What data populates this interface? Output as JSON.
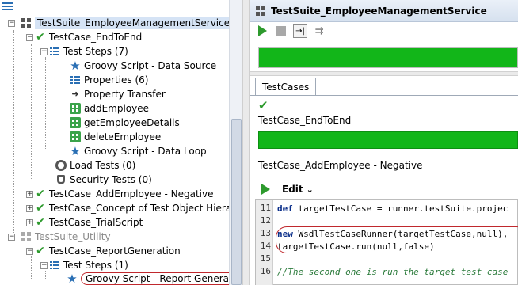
{
  "tree": {
    "suite": "TestSuite_EmployeeManagementService",
    "tc_end_to_end": "TestCase_EndToEnd",
    "test_steps_1": "Test Steps (7)",
    "step_groovy_ds": "Groovy Script - Data Source",
    "step_properties": "Properties (6)",
    "step_transfer": "Property Transfer",
    "step_add": "addEmployee",
    "step_get": "getEmployeeDetails",
    "step_delete": "deleteEmployee",
    "step_groovy_loop": "Groovy Script - Data Loop",
    "load_tests": "Load Tests (0)",
    "security_tests": "Security Tests (0)",
    "tc_add_negative": "TestCase_AddEmployee - Negative",
    "tc_concept": "TestCase_Concept of Test Object Hierarch",
    "tc_trial": "TestCase_TrialScript",
    "suite_utility": "TestSuite_Utility",
    "tc_report": "TestCase_ReportGeneration",
    "test_steps_2": "Test Steps (1)",
    "step_groovy_report": "Groovy Script - Report Generation"
  },
  "panel": {
    "title": "TestSuite_EmployeeManagementService",
    "progress": 1.0,
    "tab": "TestCases",
    "tc1": "TestCase_EndToEnd",
    "tc2": "TestCase_AddEmployee - Negative",
    "edit_label": "Edit",
    "edit_chevron": "⌄"
  },
  "code": {
    "lines": [
      {
        "n": "11",
        "kw": "def",
        "rest": " targetTestCase = runner.testSuite.projec"
      },
      {
        "n": "12",
        "kw": "",
        "rest": ""
      },
      {
        "n": "13",
        "kw": "new",
        "rest": " WsdlTestCaseRunner(targetTestCase,null),"
      },
      {
        "n": "14",
        "kw": "",
        "rest": "targetTestCase.run(null,false)"
      },
      {
        "n": "15",
        "kw": "",
        "rest": ""
      },
      {
        "n": "16",
        "kw": "",
        "rest": "//The second one is run the target test case"
      }
    ]
  },
  "colors": {
    "progress_green": "#12b619",
    "check_green": "#2d9a2d",
    "oval_red": "#c0282d",
    "selection": "#d5e3f5"
  },
  "icons": [
    "suite-icon",
    "check-icon",
    "steps-icon",
    "star-icon",
    "transfer-icon",
    "soap-icon",
    "gauge-icon",
    "shield-icon",
    "play-icon",
    "stop-icon"
  ]
}
